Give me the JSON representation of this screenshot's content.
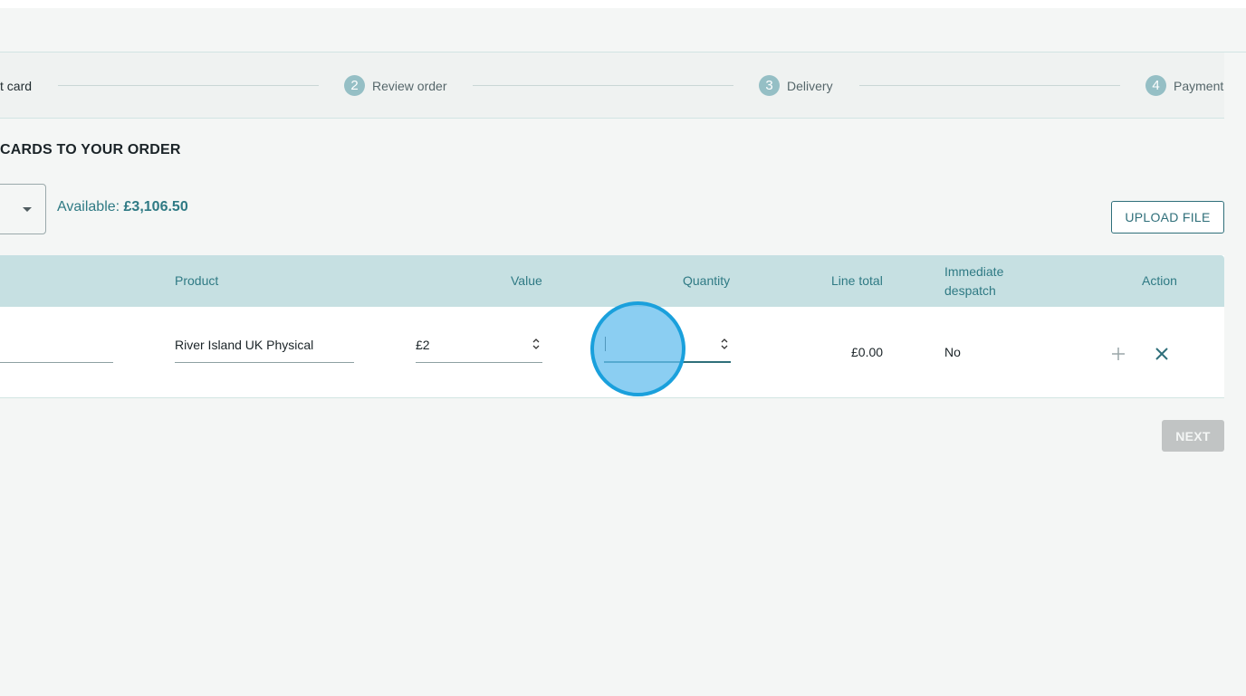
{
  "stepper": {
    "steps": [
      {
        "number": "",
        "label": "t card"
      },
      {
        "number": "2",
        "label": "Review order"
      },
      {
        "number": "3",
        "label": "Delivery"
      },
      {
        "number": "4",
        "label": "Payment"
      }
    ]
  },
  "section": {
    "title": "CARDS TO YOUR ORDER"
  },
  "balance": {
    "label": "Available: ",
    "amount": "£3,106.50"
  },
  "buttons": {
    "upload": "UPLOAD FILE",
    "next": "NEXT"
  },
  "table": {
    "columns": {
      "product": "Product",
      "value": "Value",
      "quantity": "Quantity",
      "line_total": "Line total",
      "immediate_despatch_line1": "Immediate",
      "immediate_despatch_line2": "despatch",
      "action": "Action"
    },
    "rows": [
      {
        "product": "River Island UK Physical",
        "value": "£2",
        "quantity": "",
        "line_total": "£0.00",
        "immediate_despatch": "No"
      }
    ]
  },
  "colors": {
    "accent": "#2f7a84",
    "header_bg": "#c6e0e2",
    "step_circle": "#95bfc5",
    "disabled_button": "#c1c4c4",
    "click_marker": "#1aa0dc"
  },
  "icons": {
    "dropdown": "caret-down-icon",
    "spinner": "up-down-chevron-icon",
    "add": "plus-icon",
    "remove": "close-icon"
  }
}
